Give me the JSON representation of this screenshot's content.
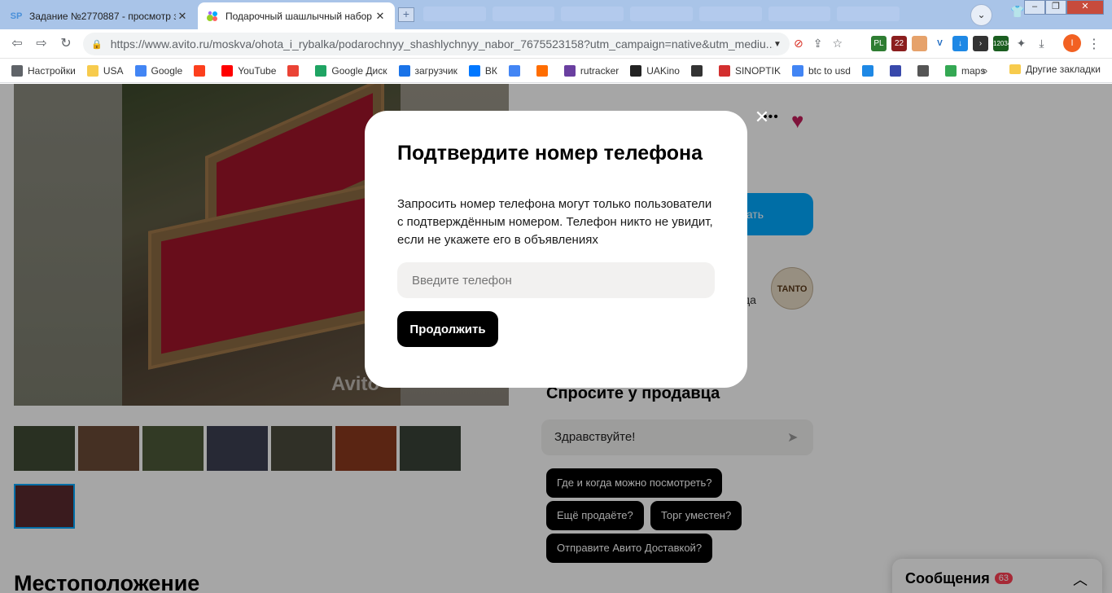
{
  "browser": {
    "tabs": [
      {
        "title": "Задание №2770887 - просмотр з",
        "favicon": "SP"
      },
      {
        "title": "Подарочный шашлычный набор",
        "favicon": "avito"
      }
    ],
    "url": "https://www.avito.ru/moskva/ohota_i_rybalka/podarochnyy_shashlychnyy_nabor_7675523158?utm_campaign=native&utm_mediu...",
    "extension_badges": {
      "pl": "PL",
      "count22": "22",
      "btc": "12034"
    },
    "user_initial": "I",
    "bookmarks": [
      {
        "label": "Настройки",
        "icon": "gear-icon",
        "color": "#5f6368"
      },
      {
        "label": "USA",
        "icon": "folder-icon",
        "color": "#f7cb4d"
      },
      {
        "label": "Google",
        "icon": "google-icon",
        "color": "#4285f4"
      },
      {
        "label": "",
        "icon": "yandex-icon",
        "color": "#fc3f1d"
      },
      {
        "label": "YouTube",
        "icon": "youtube-icon",
        "color": "#ff0000"
      },
      {
        "label": "",
        "icon": "gmail-icon",
        "color": "#ea4335"
      },
      {
        "label": "Google Диск",
        "icon": "drive-icon",
        "color": "#1fa463"
      },
      {
        "label": "загрузчик",
        "icon": "infinity-icon",
        "color": "#1a73e8"
      },
      {
        "label": "ВК",
        "icon": "vk-icon",
        "color": "#0077ff"
      },
      {
        "label": "",
        "icon": "translate-icon",
        "color": "#4285f4"
      },
      {
        "label": "",
        "icon": "f-icon",
        "color": "#ff6d00"
      },
      {
        "label": "rutracker",
        "icon": "rutracker-icon",
        "color": "#6a3fa0"
      },
      {
        "label": "UAKino",
        "icon": "uakino-icon",
        "color": "#222222"
      },
      {
        "label": "",
        "icon": "pawn-icon",
        "color": "#333333"
      },
      {
        "label": "SINOPTIK",
        "icon": "thermometer-icon",
        "color": "#d32f2f"
      },
      {
        "label": "btc to usd",
        "icon": "google-icon",
        "color": "#4285f4"
      },
      {
        "label": "",
        "icon": "p-icon",
        "color": "#1e88e5"
      },
      {
        "label": "",
        "icon": "arrow-icon",
        "color": "#3949ab"
      },
      {
        "label": "",
        "icon": "bc-icon",
        "color": "#555555"
      },
      {
        "label": "maps",
        "icon": "maps-icon",
        "color": "#34a853"
      }
    ],
    "bookmarks_more": "»",
    "other_bookmarks": "Другие закладки"
  },
  "page": {
    "photo_watermark": "Avito",
    "location_heading": "Местоположение",
    "write_button_fragment": "исать",
    "seller_fragment": "да",
    "seller_logo": "TANTO",
    "ask_heading": "Спросите у продавца",
    "ask_placeholder": "Здравствуйте!",
    "quick_questions": [
      "Где и когда можно посмотреть?",
      "Ещё продаёте?",
      "Торг уместен?",
      "Отправите Авито Доставкой?"
    ],
    "messages_label": "Сообщения",
    "messages_count": "63"
  },
  "modal": {
    "title": "Подтвердите номер телефона",
    "text": "Запросить номер телефона могут только пользователи с подтверждённым номером. Телефон никто не увидит, если не укажете его в объявлениях",
    "input_placeholder": "Введите телефон",
    "continue_label": "Продолжить",
    "close_symbol": "✕"
  },
  "colors": {
    "accent_blue": "#00aaff",
    "heart": "#c41e5b",
    "badge_red": "#ff4053"
  }
}
